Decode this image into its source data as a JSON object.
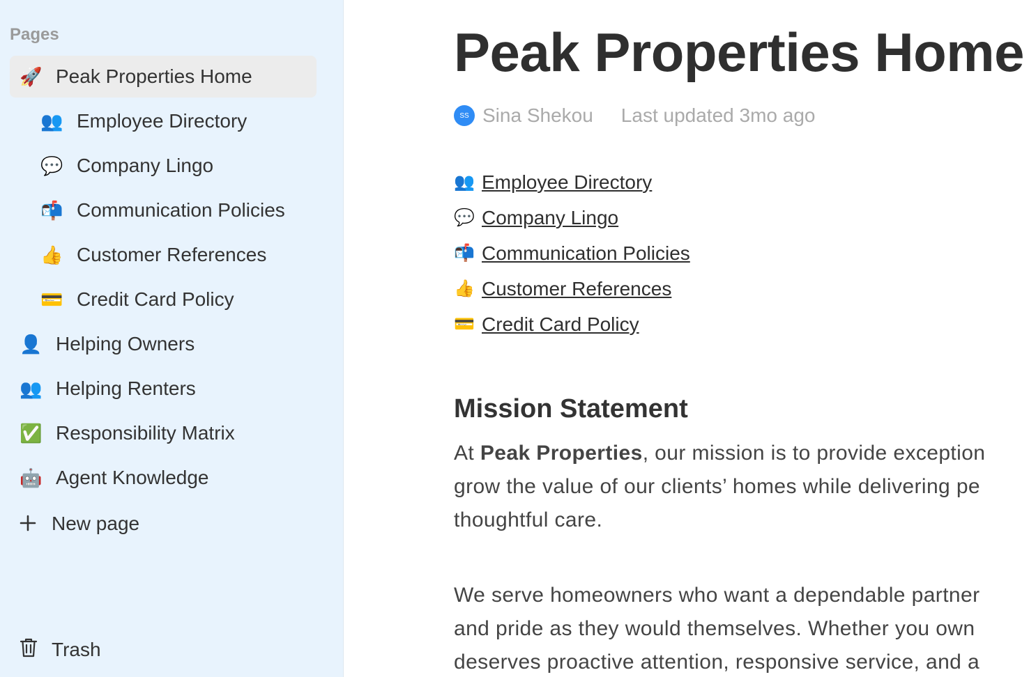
{
  "sidebar": {
    "heading": "Pages",
    "items": [
      {
        "emoji": "🚀",
        "label": "Peak Properties Home"
      },
      {
        "emoji": "👥",
        "label": "Employee Directory"
      },
      {
        "emoji": "💬",
        "label": "Company Lingo"
      },
      {
        "emoji": "📬",
        "label": "Communication Policies"
      },
      {
        "emoji": "👍",
        "label": "Customer References"
      },
      {
        "emoji": "💳",
        "label": "Credit Card Policy"
      },
      {
        "emoji": "👤",
        "label": "Helping Owners"
      },
      {
        "emoji": "👥",
        "label": "Helping Renters"
      },
      {
        "emoji": "✅",
        "label": "Responsibility Matrix"
      },
      {
        "emoji": "🤖",
        "label": "Agent Knowledge"
      }
    ],
    "new_page_label": "New page",
    "trash_label": "Trash"
  },
  "page": {
    "title": "Peak Properties Home",
    "author_initials": "SS",
    "author": "Sina Shekou",
    "last_updated": "Last updated 3mo ago",
    "links": [
      {
        "emoji": "👥",
        "label": "Employee Directory"
      },
      {
        "emoji": "💬",
        "label": "Company Lingo"
      },
      {
        "emoji": "📬",
        "label": "Communication Policies"
      },
      {
        "emoji": "👍",
        "label": "Customer References"
      },
      {
        "emoji": "💳",
        "label": "Credit Card Policy"
      }
    ],
    "section_heading": "Mission Statement",
    "para1": {
      "prefix": "At ",
      "bold": "Peak Properties",
      "line1_rest": ", our mission is to provide exception",
      "line2": "grow the value of our clients’ homes while delivering pe",
      "line3": "thoughtful care."
    },
    "para2": {
      "line1": "We serve homeowners who want a dependable partner",
      "line2": "and pride as they would themselves. Whether you own",
      "line3": "deserves proactive attention, responsive service, and a"
    }
  },
  "colors": {
    "sidebar_bg": "#e8f3fd",
    "active_item_bg": "#ececec",
    "avatar": "#2f8cf5",
    "muted_text": "#aaaaaa"
  }
}
